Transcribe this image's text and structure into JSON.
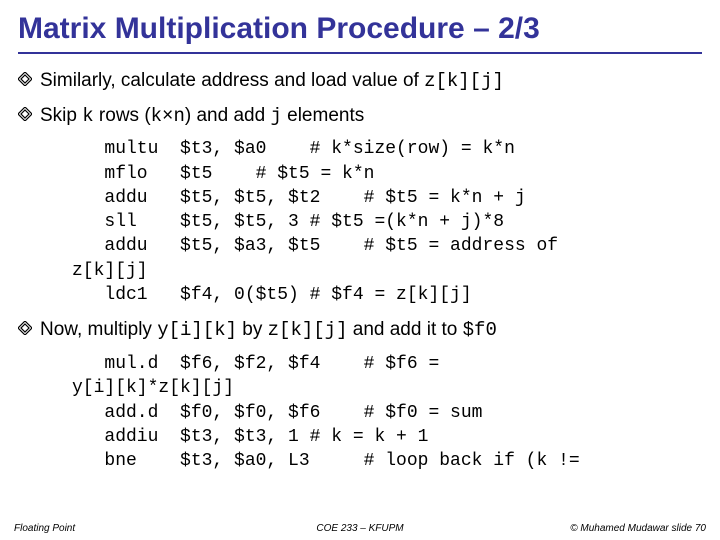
{
  "title": "Matrix Multiplication Procedure – 2/3",
  "bullets": {
    "b1_pre": "Similarly, calculate address and load value of ",
    "b1_code": "z[k][j]",
    "b2_pre": "Skip ",
    "b2_c1": "k",
    "b2_mid1": " rows (",
    "b2_c2": "k×n",
    "b2_mid2": ") and add ",
    "b2_c3": "j",
    "b2_post": " elements",
    "b3_pre": "Now, multiply ",
    "b3_c1": "y[i][k]",
    "b3_mid": " by ",
    "b3_c2": "z[k][j]",
    "b3_post1": " and add it to ",
    "b3_c3": "$f0"
  },
  "code1": "multu  $t3, $a0    # k*size(row) = k*n\nmflo   $t5    # $t5 = k*n\naddu   $t5, $t5, $t2    # $t5 = k*n + j\nsll    $t5, $t5, 3 # $t5 =(k*n + j)*8\naddu   $t5, $a3, $t5    # $t5 = address of z[k][j]\nldc1   $f4, 0($t5) # $f4 = z[k][j]",
  "code1_display": "   multu  $t3, $a0    # k*size(row) = k*n\n   mflo   $t5    # $t5 = k*n\n   addu   $t5, $t5, $t2    # $t5 = k*n + j\n   sll    $t5, $t5, 3 # $t5 =(k*n + j)*8\n   addu   $t5, $a3, $t5    # $t5 = address of\nz[k][j]\n   ldc1   $f4, 0($t5) # $f4 = z[k][j]",
  "code2_display": "   mul.d  $f6, $f2, $f4    # $f6 =\ny[i][k]*z[k][j]\n   add.d  $f0, $f0, $f6    # $f0 = sum\n   addiu  $t3, $t3, 1 # k = k + 1\n   bne    $t3, $a0, L3     # loop back if (k !=",
  "footer": {
    "left": "Floating Point",
    "center": "COE 233 – KFUPM",
    "right": "© Muhamed Mudawar   slide 70"
  }
}
